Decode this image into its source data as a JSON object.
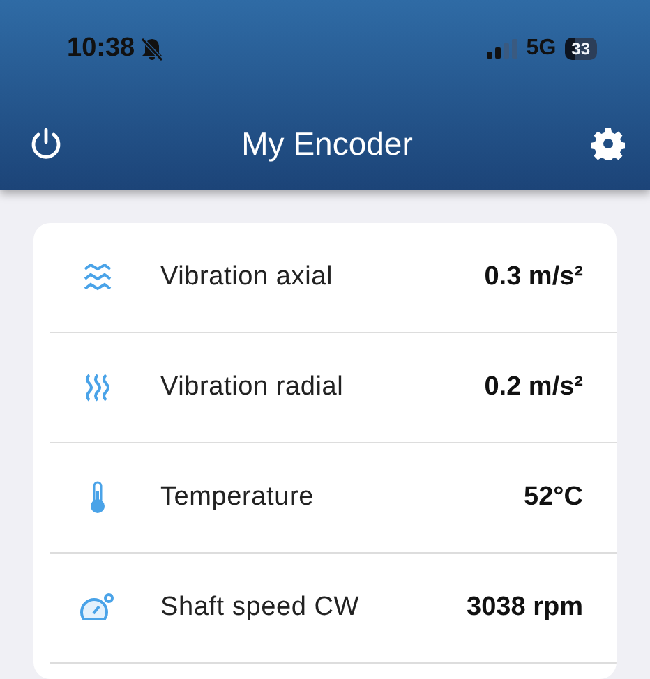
{
  "status_bar": {
    "time": "10:38",
    "network": "5G",
    "battery": "33"
  },
  "header": {
    "title": "My Encoder"
  },
  "measurements": [
    {
      "kind": "axial",
      "label": "Vibration axial",
      "value": "0.3 m/s²"
    },
    {
      "kind": "radial",
      "label": "Vibration radial",
      "value": "0.2 m/s²"
    },
    {
      "kind": "temperature",
      "label": "Temperature",
      "value": "52°C"
    },
    {
      "kind": "speed",
      "label": "Shaft speed CW",
      "value": "3038 rpm"
    }
  ]
}
